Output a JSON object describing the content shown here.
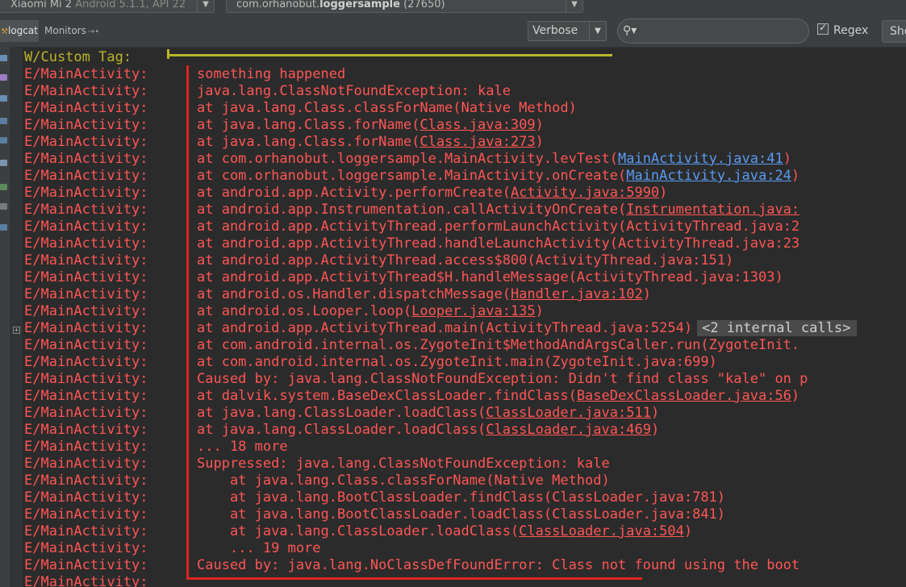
{
  "topbar": {
    "device_name": "Xiaomi Mi 2",
    "device_info": " Android 5.1.1, API 22",
    "process_prefix": "com.orhanobut.",
    "process_bold": "loggersample",
    "process_pid": " (27650)"
  },
  "toolbar": {
    "tab_logcat": "logcat",
    "tab_monitors": "Monitors",
    "log_level": "Verbose",
    "search_value": "",
    "regex_label": "Regex",
    "regex_checked": true,
    "show_label": "Show"
  },
  "colors": {
    "error": "#ff5555",
    "warn": "#bbb529",
    "link": "#5a9bf3",
    "border": "#e02424",
    "background": "#2b2b2b"
  },
  "log": {
    "lines": [
      {
        "tag": "W/Custom Tag:",
        "level": "warn",
        "parts": []
      },
      {
        "tag": "E/MainActivity:",
        "level": "error",
        "parts": [
          {
            "text": "something happened"
          }
        ]
      },
      {
        "tag": "E/MainActivity:",
        "level": "error",
        "parts": [
          {
            "text": "java.lang.ClassNotFoundException: kale"
          }
        ]
      },
      {
        "tag": "E/MainActivity:",
        "level": "error",
        "parts": [
          {
            "text": "at java.lang.Class.classForName(Native Method)"
          }
        ]
      },
      {
        "tag": "E/MainActivity:",
        "level": "error",
        "parts": [
          {
            "text": "at java.lang.Class.forName("
          },
          {
            "text": "Class.java:309",
            "style": "ul"
          },
          {
            "text": ")"
          }
        ]
      },
      {
        "tag": "E/MainActivity:",
        "level": "error",
        "parts": [
          {
            "text": "at java.lang.Class.forName("
          },
          {
            "text": "Class.java:273",
            "style": "ul"
          },
          {
            "text": ")"
          }
        ]
      },
      {
        "tag": "E/MainActivity:",
        "level": "error",
        "parts": [
          {
            "text": "at com.orhanobut.loggersample.MainActivity.levTest("
          },
          {
            "text": "MainActivity.java:41",
            "style": "link"
          },
          {
            "text": ")"
          }
        ]
      },
      {
        "tag": "E/MainActivity:",
        "level": "error",
        "parts": [
          {
            "text": "at com.orhanobut.loggersample.MainActivity.onCreate("
          },
          {
            "text": "MainActivity.java:24",
            "style": "link"
          },
          {
            "text": ")"
          }
        ]
      },
      {
        "tag": "E/MainActivity:",
        "level": "error",
        "parts": [
          {
            "text": "at android.app.Activity.performCreate("
          },
          {
            "text": "Activity.java:5990",
            "style": "ul"
          },
          {
            "text": ")"
          }
        ]
      },
      {
        "tag": "E/MainActivity:",
        "level": "error",
        "parts": [
          {
            "text": "at android.app.Instrumentation.callActivityOnCreate("
          },
          {
            "text": "Instrumentation.java:",
            "style": "ul"
          }
        ]
      },
      {
        "tag": "E/MainActivity:",
        "level": "error",
        "parts": [
          {
            "text": "at android.app.ActivityThread.performLaunchActivity(ActivityThread.java:2"
          }
        ]
      },
      {
        "tag": "E/MainActivity:",
        "level": "error",
        "parts": [
          {
            "text": "at android.app.ActivityThread.handleLaunchActivity(ActivityThread.java:23"
          }
        ]
      },
      {
        "tag": "E/MainActivity:",
        "level": "error",
        "parts": [
          {
            "text": "at android.app.ActivityThread.access$800(ActivityThread.java:151)"
          }
        ]
      },
      {
        "tag": "E/MainActivity:",
        "level": "error",
        "parts": [
          {
            "text": "at android.app.ActivityThread$H.handleMessage(ActivityThread.java:1303)"
          }
        ]
      },
      {
        "tag": "E/MainActivity:",
        "level": "error",
        "parts": [
          {
            "text": "at android.os.Handler.dispatchMessage("
          },
          {
            "text": "Handler.java:102",
            "style": "ul"
          },
          {
            "text": ")"
          }
        ]
      },
      {
        "tag": "E/MainActivity:",
        "level": "error",
        "parts": [
          {
            "text": "at android.os.Looper.loop("
          },
          {
            "text": "Looper.java:135",
            "style": "ul"
          },
          {
            "text": ")"
          }
        ]
      },
      {
        "tag": "E/MainActivity:",
        "level": "error",
        "parts": [
          {
            "text": "at android.app.ActivityThread.main(ActivityThread.java:5254)"
          },
          {
            "text": "<2 internal calls>",
            "style": "badge"
          }
        ]
      },
      {
        "tag": "E/MainActivity:",
        "level": "error",
        "parts": [
          {
            "text": "at com.android.internal.os.ZygoteInit$MethodAndArgsCaller.run(ZygoteInit."
          }
        ]
      },
      {
        "tag": "E/MainActivity:",
        "level": "error",
        "parts": [
          {
            "text": "at com.android.internal.os.ZygoteInit.main(ZygoteInit.java:699)"
          }
        ]
      },
      {
        "tag": "E/MainActivity:",
        "level": "error",
        "parts": [
          {
            "text": "Caused by: java.lang.ClassNotFoundException: Didn't find class \"kale\" on p"
          }
        ]
      },
      {
        "tag": "E/MainActivity:",
        "level": "error",
        "parts": [
          {
            "text": "at dalvik.system.BaseDexClassLoader.findClass("
          },
          {
            "text": "BaseDexClassLoader.java:56",
            "style": "ul"
          },
          {
            "text": ")"
          }
        ]
      },
      {
        "tag": "E/MainActivity:",
        "level": "error",
        "parts": [
          {
            "text": "at java.lang.ClassLoader.loadClass("
          },
          {
            "text": "ClassLoader.java:511",
            "style": "ul"
          },
          {
            "text": ")"
          }
        ]
      },
      {
        "tag": "E/MainActivity:",
        "level": "error",
        "parts": [
          {
            "text": "at java.lang.ClassLoader.loadClass("
          },
          {
            "text": "ClassLoader.java:469",
            "style": "ul"
          },
          {
            "text": ")"
          }
        ]
      },
      {
        "tag": "E/MainActivity:",
        "level": "error",
        "parts": [
          {
            "text": "... 18 more"
          }
        ]
      },
      {
        "tag": "E/MainActivity:",
        "level": "error",
        "parts": [
          {
            "text": "Suppressed: java.lang.ClassNotFoundException: kale"
          }
        ]
      },
      {
        "tag": "E/MainActivity:",
        "level": "error",
        "parts": [
          {
            "text": "    at java.lang.Class.classForName(Native Method)"
          }
        ]
      },
      {
        "tag": "E/MainActivity:",
        "level": "error",
        "parts": [
          {
            "text": "    at java.lang.BootClassLoader.findClass(ClassLoader.java:781)"
          }
        ]
      },
      {
        "tag": "E/MainActivity:",
        "level": "error",
        "parts": [
          {
            "text": "    at java.lang.BootClassLoader.loadClass(ClassLoader.java:841)"
          }
        ]
      },
      {
        "tag": "E/MainActivity:",
        "level": "error",
        "parts": [
          {
            "text": "    at java.lang.ClassLoader.loadClass("
          },
          {
            "text": "ClassLoader.java:504",
            "style": "ul"
          },
          {
            "text": ")"
          }
        ]
      },
      {
        "tag": "E/MainActivity:",
        "level": "error",
        "parts": [
          {
            "text": "    ... 19 more"
          }
        ]
      },
      {
        "tag": "E/MainActivity:",
        "level": "error",
        "parts": [
          {
            "text": "Caused by: java.lang.NoClassDefFoundError: Class not found using the boot"
          }
        ]
      },
      {
        "tag": "E/MainActivity:",
        "level": "error",
        "parts": []
      }
    ]
  }
}
